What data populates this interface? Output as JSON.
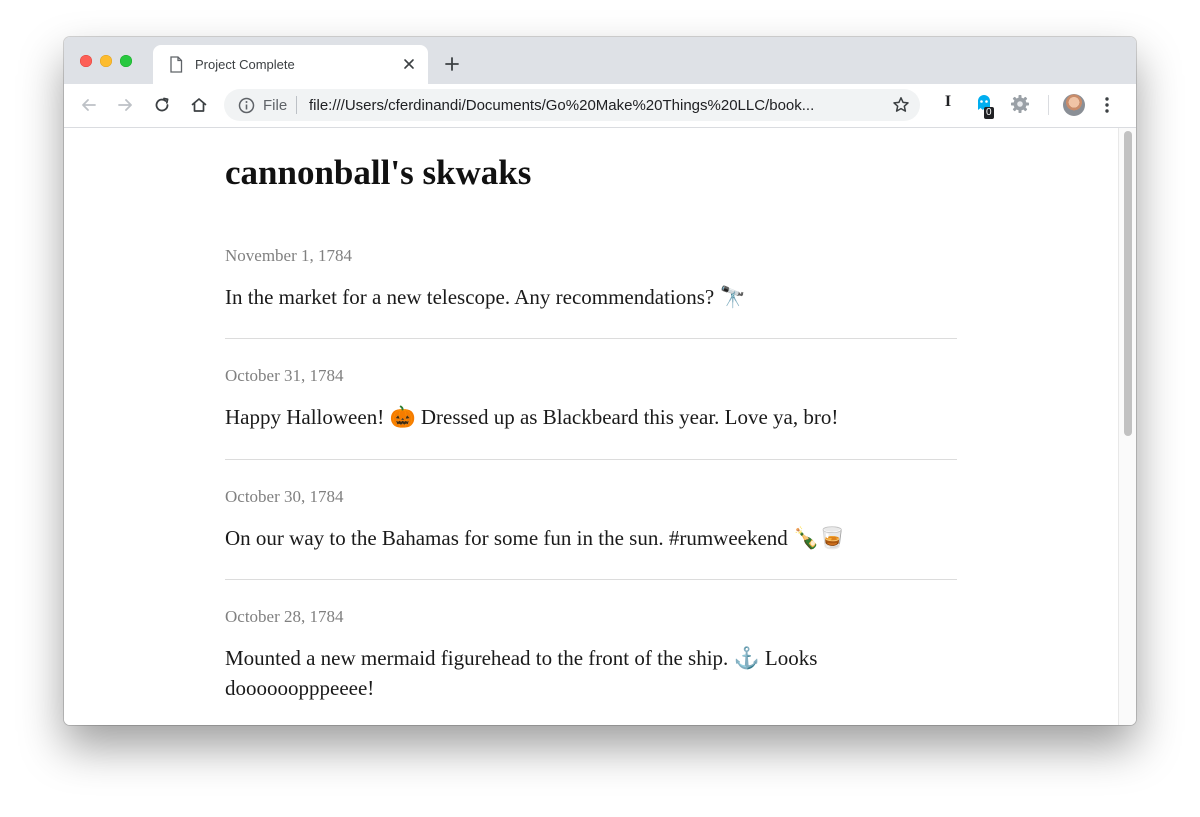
{
  "browser": {
    "tab": {
      "title": "Project Complete",
      "close_glyph": "✕",
      "icon": "document-icon"
    },
    "new_tab_glyph": "+",
    "address": {
      "scheme_chip": "File",
      "url": "file:///Users/cferdinandi/Documents/Go%20Make%20Things%20LLC/book..."
    },
    "extensions": {
      "ext_i_label": "I",
      "ghost_badge": "0"
    }
  },
  "page": {
    "title": "cannonball's skwaks",
    "posts": [
      {
        "date": "November 1, 1784",
        "text": "In the market for a new telescope. Any recommendations? 🔭"
      },
      {
        "date": "October 31, 1784",
        "text": "Happy Halloween! 🎃  Dressed up as Blackbeard this year. Love ya, bro!"
      },
      {
        "date": "October 30, 1784",
        "text": "On our way to the Bahamas for some fun in the sun. #rumweekend 🍾🥃"
      },
      {
        "date": "October 28, 1784",
        "text": "Mounted a new mermaid figurehead to the front of the ship. ⚓  Looks doooooopppeeee!"
      }
    ]
  }
}
